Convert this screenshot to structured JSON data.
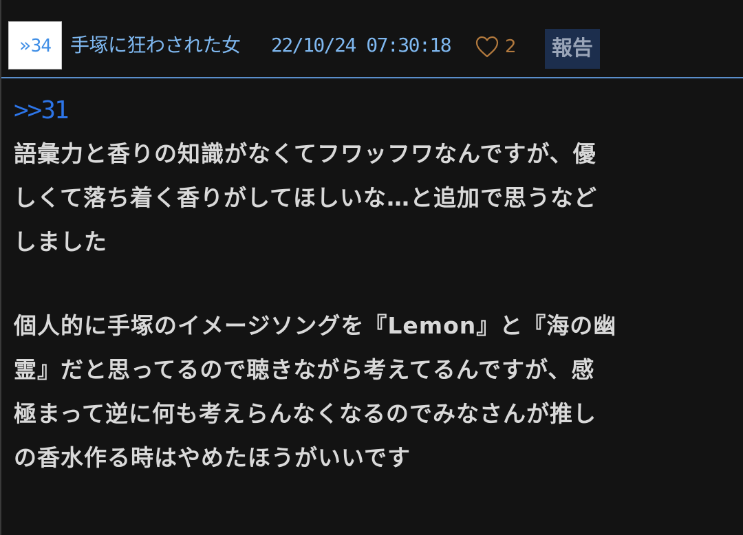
{
  "post": {
    "res_number": "34",
    "author": "手塚に狂わされた女",
    "date": "22/10/24 07:30:18",
    "like_count": "2",
    "report_label": "報告",
    "reply_anchor": ">>31",
    "paragraph1": [
      "語彙力と香りの知識がなくてフワッフワなんですが、優",
      "しくて落ち着く香りがしてほしいな…と追加で思うなど",
      "しました"
    ],
    "paragraph2": [
      "個人的に手塚のイメージソングを『Lemon』と『海の幽",
      "霊』だと思ってるので聴きながら考えてるんですが、感",
      "極まって逆に何も考えらんなくなるのでみなさんが推し",
      "の香水作る時はやめたほうがいいです"
    ]
  },
  "colors": {
    "background": "#131313",
    "accent_blue": "#7fb8f0",
    "anchor_blue": "#2d75e8",
    "like_brown": "#b37a3e",
    "report_bg": "#1c2e4d",
    "divider": "#5a8ecb"
  },
  "icons": {
    "like": "heart-outline-icon",
    "res_chevron": "double-chevron-right-icon"
  }
}
